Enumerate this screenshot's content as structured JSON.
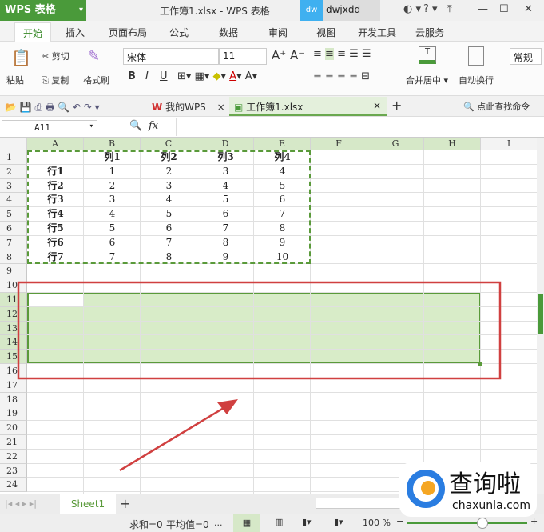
{
  "app": {
    "logo": "WPS 表格",
    "doc_title": "工作簿1.xlsx - WPS 表格",
    "user_badge": "dw",
    "user": "dwjxdd"
  },
  "tabs": [
    "开始",
    "插入",
    "页面布局",
    "公式",
    "数据",
    "审阅",
    "视图",
    "开发工具",
    "云服务"
  ],
  "ribbon": {
    "paste": "粘贴",
    "cut": "剪切",
    "copy": "复制",
    "format_painter": "格式刷",
    "font": "宋体",
    "size": "11",
    "bold": "B",
    "italic": "I",
    "underline": "U",
    "merge": "合并居中",
    "wrap": "自动换行",
    "number_format": "常规"
  },
  "doc_tabs": {
    "mywps": "我的WPS",
    "file": "工作簿1.xlsx",
    "search": "点此查找命令"
  },
  "formula": {
    "name_box": "A11",
    "fx": "fx",
    "value": ""
  },
  "columns": [
    "A",
    "B",
    "C",
    "D",
    "E",
    "F",
    "G",
    "H",
    "I"
  ],
  "rows": [
    "1",
    "2",
    "3",
    "4",
    "5",
    "6",
    "7",
    "8",
    "9",
    "10",
    "11",
    "12",
    "13",
    "14",
    "15",
    "16",
    "17",
    "18",
    "19",
    "20",
    "21",
    "22",
    "23",
    "24"
  ],
  "cells": [
    [
      "",
      "列1",
      "列2",
      "列3",
      "列4"
    ],
    [
      "行1",
      "1",
      "2",
      "3",
      "4"
    ],
    [
      "行2",
      "2",
      "3",
      "4",
      "5"
    ],
    [
      "行3",
      "3",
      "4",
      "5",
      "6"
    ],
    [
      "行4",
      "4",
      "5",
      "6",
      "7"
    ],
    [
      "行5",
      "5",
      "6",
      "7",
      "8"
    ],
    [
      "行6",
      "6",
      "7",
      "8",
      "9"
    ],
    [
      "行7",
      "7",
      "8",
      "9",
      "10"
    ]
  ],
  "sheet": {
    "name": "Sheet1"
  },
  "status": {
    "sum": "求和=0",
    "avg": "平均值=0",
    "more": "...",
    "zoom": "100 %",
    "zoom_fraction": 0.5
  },
  "watermark": {
    "text": "查询啦",
    "url": "chaxunla.com"
  },
  "colors": {
    "accent": "#4a9a3a",
    "selection": "#d8ecc8",
    "annotation": "#d04040"
  }
}
